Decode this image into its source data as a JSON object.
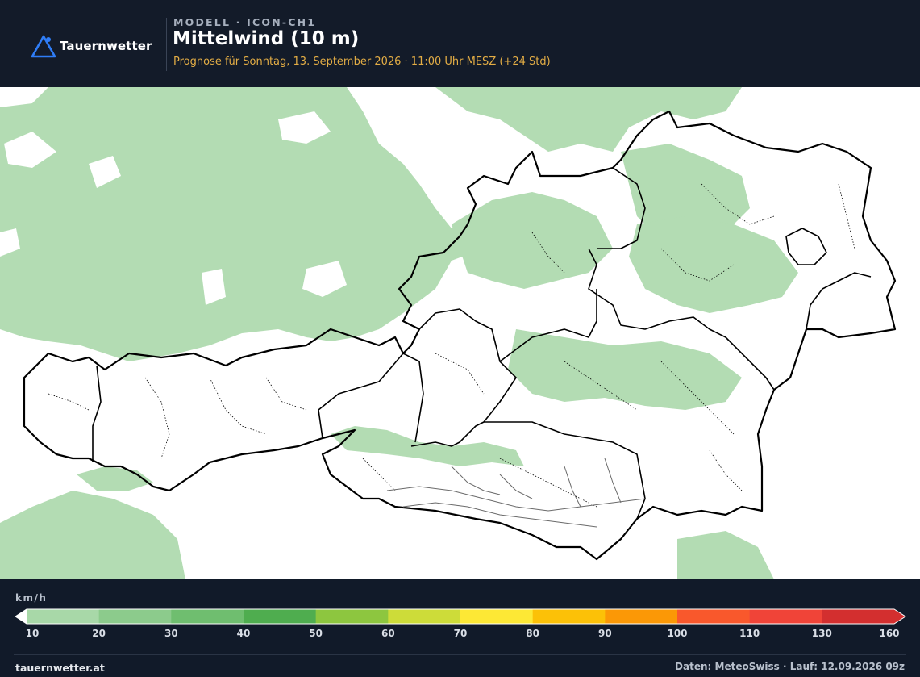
{
  "header": {
    "logo_text": "Tauernwetter",
    "model_line": "MODELL · ICON-CH1",
    "title": "Mittelwind (10 m)",
    "subtitle": "Prognose für Sonntag, 13. September 2026 · 11:00 Uhr MESZ  (+24 Std)"
  },
  "legend": {
    "unit": "km/h",
    "ticks": [
      "10",
      "20",
      "30",
      "40",
      "50",
      "60",
      "70",
      "80",
      "90",
      "100",
      "110",
      "130",
      "160"
    ],
    "colors": [
      "#a8d8a8",
      "#8ccb8c",
      "#6fbe6f",
      "#4fad4f",
      "#8dc63f",
      "#cddc39",
      "#fde835",
      "#fcc107",
      "#fb9806",
      "#f9582c",
      "#f04438",
      "#d32f2f"
    ],
    "under_color": "#ffffff",
    "over_color": "#d32f2f"
  },
  "map": {
    "wind_class_shown": "10–20 km/h",
    "fill_color": "#b3dcb3",
    "background_color": "#ffffff"
  },
  "footer": {
    "site": "tauernwetter.at",
    "source": "Daten: MeteoSwiss · Lauf: 12.09.2026 09z"
  }
}
